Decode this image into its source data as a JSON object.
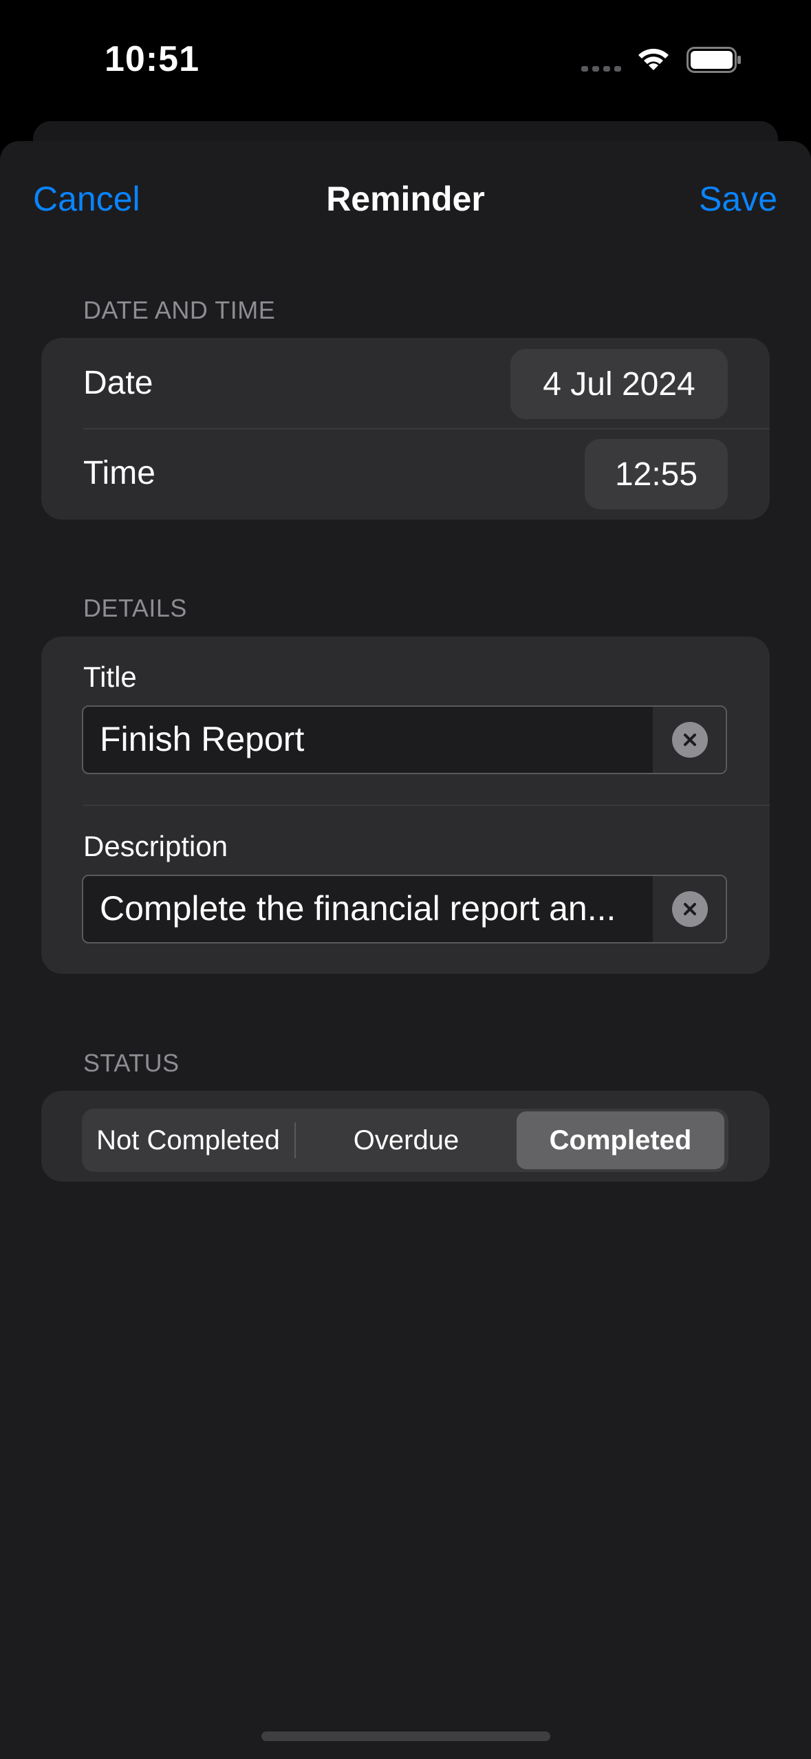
{
  "status_bar": {
    "time": "10:51"
  },
  "nav": {
    "cancel_label": "Cancel",
    "title": "Reminder",
    "save_label": "Save"
  },
  "date_time_section": {
    "header": "DATE AND TIME",
    "date_label": "Date",
    "date_value": "4 Jul 2024",
    "time_label": "Time",
    "time_value": "12:55"
  },
  "details_section": {
    "header": "DETAILS",
    "title_label": "Title",
    "title_value": "Finish Report",
    "description_label": "Description",
    "description_value": "Complete the financial report an..."
  },
  "status_section": {
    "header": "STATUS",
    "options": [
      "Not Completed",
      "Overdue",
      "Completed"
    ],
    "selected": "Completed"
  },
  "colors": {
    "accent": "#0a84ff",
    "background": "#1c1c1e",
    "card": "#2c2c2e"
  },
  "icons": {
    "clear": "xmark-circle-icon",
    "wifi": "wifi-icon",
    "battery": "battery-icon",
    "signal": "cellular-signal-icon"
  }
}
